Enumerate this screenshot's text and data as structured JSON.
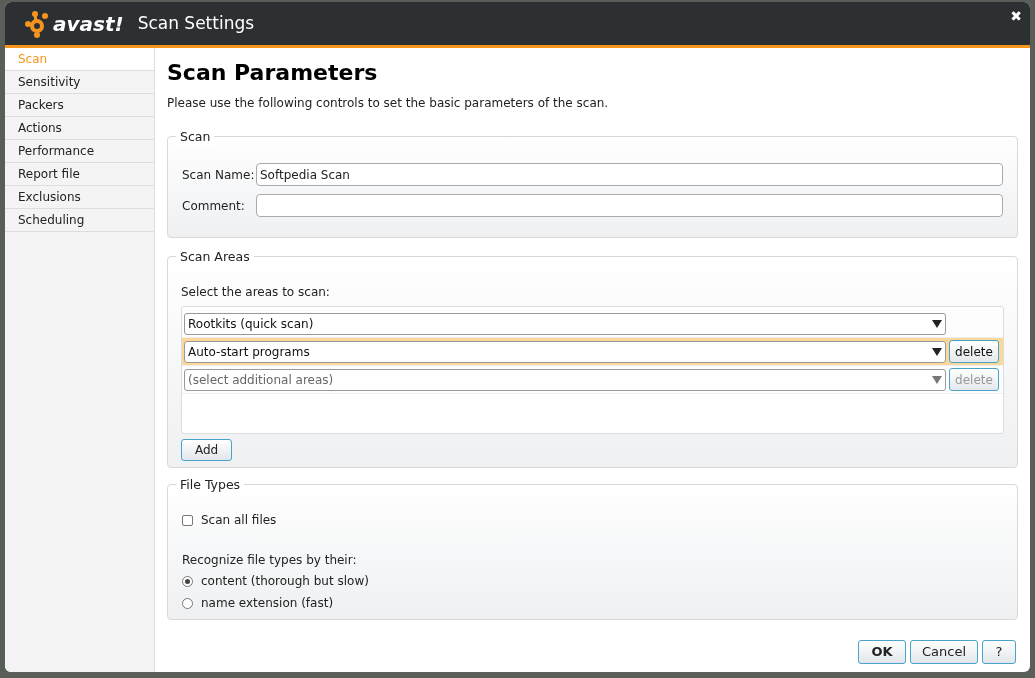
{
  "window": {
    "logo_text": "avast!",
    "title": "Scan Settings",
    "close": "✖"
  },
  "sidebar": {
    "items": [
      {
        "label": "Scan",
        "selected": true
      },
      {
        "label": "Sensitivity",
        "selected": false
      },
      {
        "label": "Packers",
        "selected": false
      },
      {
        "label": "Actions",
        "selected": false
      },
      {
        "label": "Performance",
        "selected": false
      },
      {
        "label": "Report file",
        "selected": false
      },
      {
        "label": "Exclusions",
        "selected": false
      },
      {
        "label": "Scheduling",
        "selected": false
      }
    ]
  },
  "heading": "Scan Parameters",
  "description": "Please use the following controls to set the basic parameters of the scan.",
  "scan_group": {
    "legend": "Scan",
    "fields": [
      {
        "label": "Scan Name:",
        "value": "Softpedia Scan"
      },
      {
        "label": "Comment:"
      }
    ]
  },
  "areas_group": {
    "legend": "Scan Areas",
    "prompt": "Select the areas to scan:",
    "rows": [
      {
        "value": "Rootkits (quick scan)",
        "highlighted": false
      },
      {
        "value": "Auto-start programs",
        "highlighted": true,
        "delete": {
          "label": "delete",
          "disabled": false
        }
      },
      {
        "placeholder": "(select additional areas)",
        "highlighted": false,
        "delete": {
          "label": "delete",
          "disabled": true
        }
      }
    ],
    "add_button": "Add"
  },
  "file_types_group": {
    "legend": "File Types",
    "scan_all": {
      "label": "Scan all files",
      "checked": false
    },
    "recognize_label": "Recognize file types by their:",
    "options": [
      {
        "label": "content (thorough but slow)",
        "selected": true
      },
      {
        "label": "name extension (fast)",
        "selected": false
      }
    ]
  },
  "buttons": [
    {
      "label": "OK",
      "default": true
    },
    {
      "label": "Cancel",
      "default": false
    },
    {
      "label": "?",
      "default": false
    }
  ]
}
